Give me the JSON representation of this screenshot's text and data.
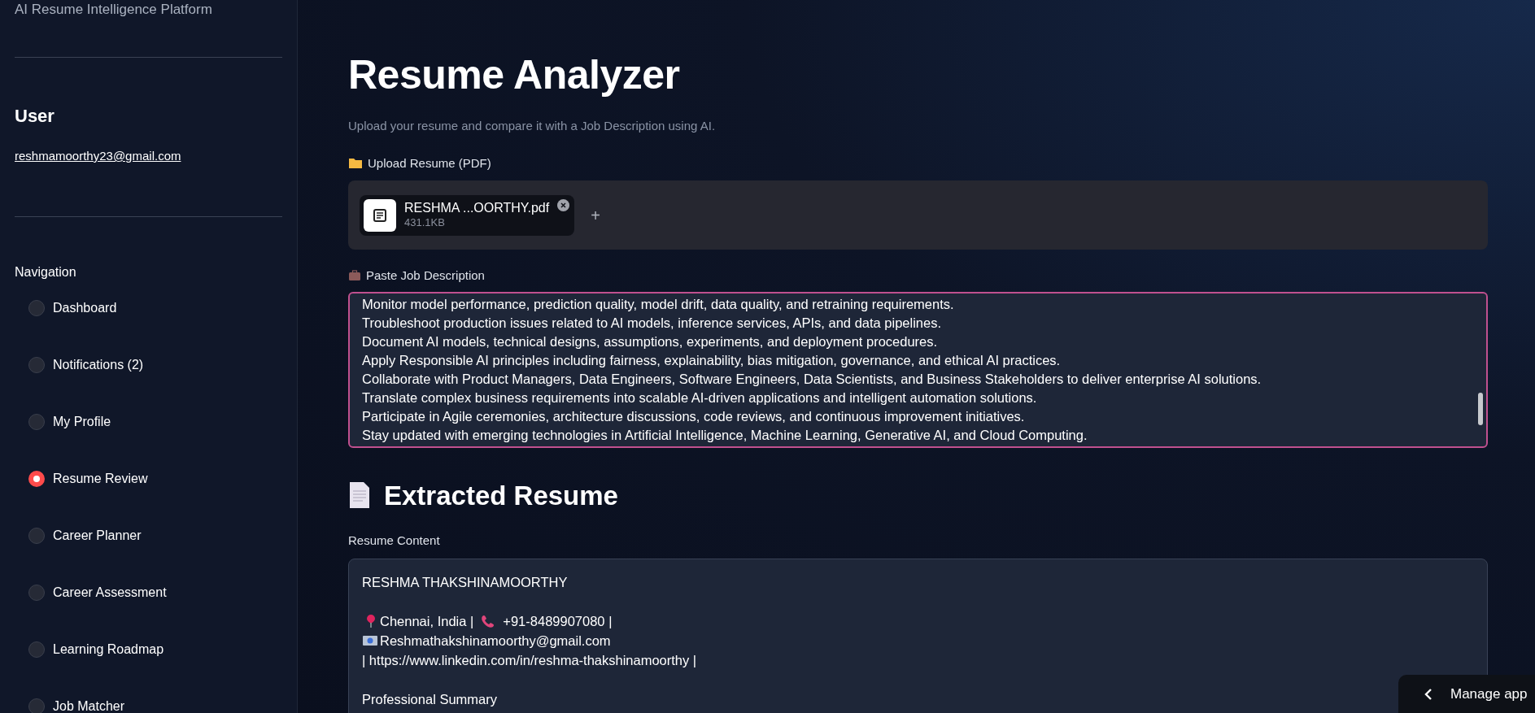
{
  "sidebar": {
    "app_title": "AI Resume Intelligence Platform",
    "user_heading": "User",
    "user_email": "reshmamoorthy23@gmail.com",
    "nav_heading": "Navigation",
    "nav_items": [
      {
        "label": "Dashboard",
        "selected": false
      },
      {
        "label": "Notifications (2)",
        "selected": false
      },
      {
        "label": "My Profile",
        "selected": false
      },
      {
        "label": "Resume Review",
        "selected": true
      },
      {
        "label": "Career Planner",
        "selected": false
      },
      {
        "label": "Career Assessment",
        "selected": false
      },
      {
        "label": "Learning Roadmap",
        "selected": false
      },
      {
        "label": "Job Matcher",
        "selected": false
      }
    ]
  },
  "main": {
    "title": "Resume Analyzer",
    "subtitle": "Upload your resume and compare it with a Job Description using AI.",
    "upload": {
      "label": "Upload Resume (PDF)",
      "file_name": "RESHMA ...OORTHY.pdf",
      "file_size": "431.1KB",
      "add_symbol": "+"
    },
    "job_description": {
      "label": "Paste Job Description",
      "lines": [
        "Monitor model performance, prediction quality, model drift, data quality, and retraining requirements.",
        "Troubleshoot production issues related to AI models, inference services, APIs, and data pipelines.",
        "Document AI models, technical designs, assumptions, experiments, and deployment procedures.",
        "Apply Responsible AI principles including fairness, explainability, bias mitigation, governance, and ethical AI practices.",
        "Collaborate with Product Managers, Data Engineers, Software Engineers, Data Scientists, and Business Stakeholders to deliver enterprise AI solutions.",
        "Translate complex business requirements into scalable AI-driven applications and intelligent automation solutions.",
        "Participate in Agile ceremonies, architecture discussions, code reviews, and continuous improvement initiatives.",
        "Stay updated with emerging technologies in Artificial Intelligence, Machine Learning, Generative AI, and Cloud Computing."
      ]
    },
    "extracted": {
      "heading": "Extracted Resume",
      "content_label": "Resume Content",
      "blocks": [
        [
          [
            {
              "kind": "text",
              "text": "RESHMA THAKSHINAMOORTHY"
            }
          ]
        ],
        [
          [
            {
              "kind": "pin"
            },
            {
              "kind": "text",
              "text": "Chennai, India |"
            },
            {
              "kind": "phone"
            },
            {
              "kind": "text",
              "text": "+91-8489907080 |"
            }
          ],
          [
            {
              "kind": "envelope"
            },
            {
              "kind": "text",
              "text": "Reshmathakshinamoorthy@gmail.com"
            }
          ],
          [
            {
              "kind": "text",
              "text": "| https://www.linkedin.com/in/reshma-thakshinamoorthy |"
            }
          ]
        ],
        [
          [
            {
              "kind": "text",
              "text": "Professional Summary"
            }
          ]
        ]
      ]
    }
  },
  "manage_app": {
    "label": "Manage app"
  }
}
